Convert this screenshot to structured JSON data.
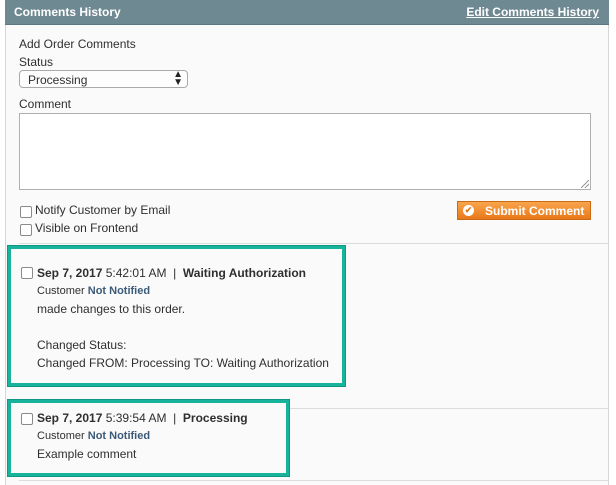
{
  "header": {
    "title": "Comments History",
    "edit_link": "Edit Comments History"
  },
  "form": {
    "add_label": "Add Order Comments",
    "status_label": "Status",
    "status_value": "Processing",
    "comment_label": "Comment",
    "comment_value": "",
    "notify_label": "Notify Customer by Email",
    "notify_checked": false,
    "visible_label": "Visible on Frontend",
    "visible_checked": false,
    "submit_label": "Submit Comment"
  },
  "entries": [
    {
      "date": "Sep 7, 2017",
      "time": "5:42:01 AM",
      "separator": "|",
      "status": "Waiting Authorization",
      "customer_label": "Customer",
      "notified": "Not Notified",
      "lines": [
        "made changes to this order.",
        "Changed Status:",
        "Changed FROM: Processing TO: Waiting Authorization"
      ]
    },
    {
      "date": "Sep 7, 2017",
      "time": "5:39:54 AM",
      "separator": "|",
      "status": "Processing",
      "customer_label": "Customer",
      "notified": "Not Notified",
      "lines": [
        "Example comment"
      ]
    }
  ],
  "colors": {
    "header_bg": "#6f8992",
    "submit_bg": "#e9781a",
    "highlight": "#17b39b",
    "not_notified": "#3b5a78"
  }
}
